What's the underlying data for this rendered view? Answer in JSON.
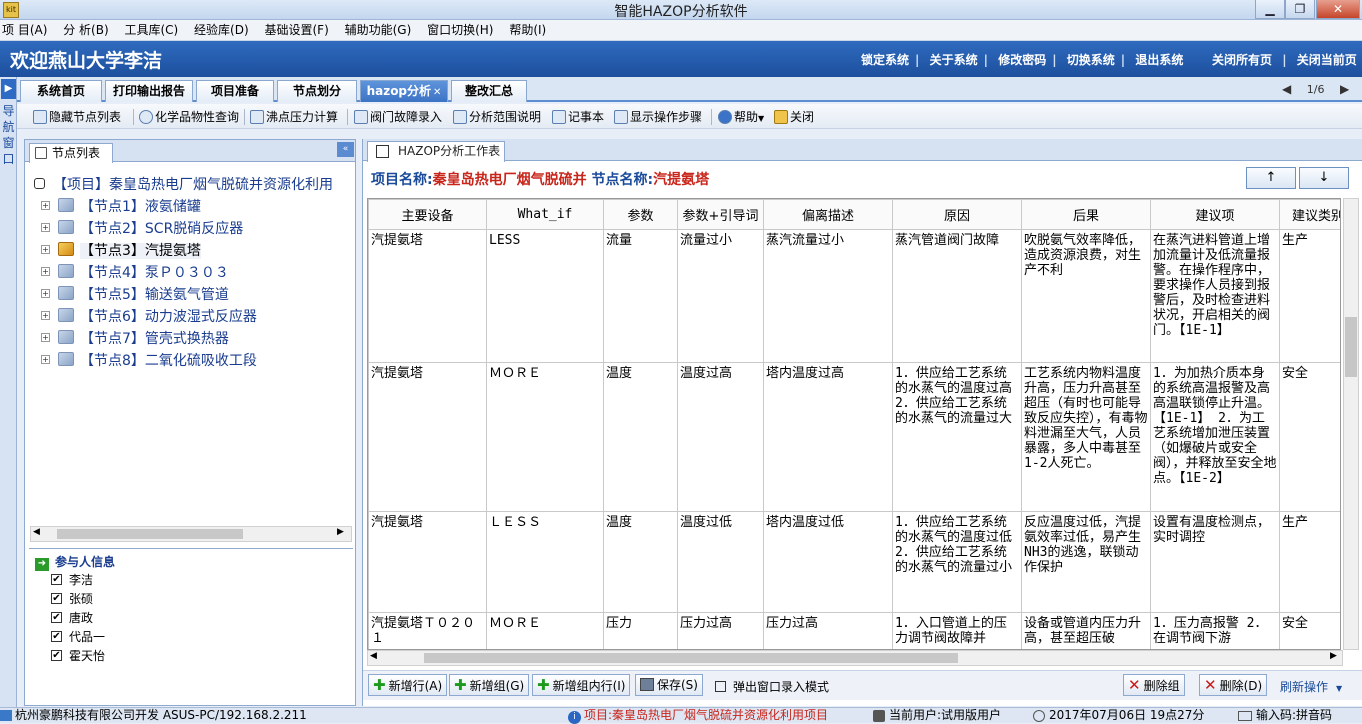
{
  "window": {
    "title": "智能HAZOP分析软件",
    "icon_text": "kit",
    "buttons": [
      "minimize-icon",
      "restore-icon",
      "close-icon"
    ]
  },
  "menu": [
    "项 目(A)",
    "分 析(B)",
    "工具库(C)",
    "经验库(D)",
    "基础设置(F)",
    "辅助功能(G)",
    "窗口切换(H)",
    "帮助(I)"
  ],
  "menu_prefix": "项",
  "header": {
    "welcome": "欢迎燕山大学李洁",
    "links": [
      "锁定系统",
      "关于系统",
      "修改密码",
      "切换系统",
      "退出系统"
    ],
    "right_links": [
      "关闭所有页",
      "关闭当前页"
    ]
  },
  "leftnav": {
    "label": "导航窗口"
  },
  "tabs": [
    "系统首页",
    "打印输出报告",
    "项目准备",
    "节点划分",
    "hazop分析",
    "整改汇总"
  ],
  "active_tab_index": 4,
  "pager": "1/6",
  "toolbar": [
    "隐藏节点列表",
    "化学品物性查询",
    "沸点压力计算",
    "阀门故障录入",
    "分析范围说明",
    "记事本",
    "显示操作步骤",
    "帮助",
    "关闭"
  ],
  "node_panel": {
    "tab": "节点列表",
    "project": "【项目】秦皇岛热电厂烟气脱硫并资源化利用",
    "nodes": [
      "【节点1】液氨储罐",
      "【节点2】SCR脱硝反应器",
      "【节点3】汽提氨塔",
      "【节点4】泵Ｐ０３０３",
      "【节点5】输送氨气管道",
      "【节点6】动力波湿式反应器",
      "【节点7】管壳式换热器",
      "【节点8】二氧化硫吸收工段"
    ],
    "selected_index": 2
  },
  "participants": {
    "title": "参与人信息",
    "people": [
      "李洁",
      "张硕",
      "唐政",
      "代品一",
      "霍天怡"
    ],
    "checked": true
  },
  "worksheet": {
    "tab": "HAZOP分析工作表",
    "project_label": "项目名称:",
    "project_name": "秦皇岛热电厂烟气脱硫并",
    "node_label": "节点名称:",
    "node_name": "汽提氨塔",
    "up_arrow": "↑",
    "down_arrow": "↓",
    "columns": [
      "主要设备",
      "What_if",
      "参数",
      "参数+引导词",
      "偏离描述",
      "原因",
      "后果",
      "建议项",
      "建议类别"
    ],
    "rows": [
      [
        "汽提氨塔",
        "LESS",
        "流量",
        "流量过小",
        "蒸汽流量过小",
        "蒸汽管道阀门故障",
        "吹脱氨气效率降低，造成资源浪费，对生产不利",
        "在蒸汽进料管道上增加流量计及低流量报警。在操作程序中，要求操作人员接到报警后，及时检查进料状况，开启相关的阀门。【1E-1】",
        "生产"
      ],
      [
        "汽提氨塔",
        "ＭＯＲＥ",
        "温度",
        "温度过高",
        "塔内温度过高",
        "1．供应给工艺系统的水蒸气的温度过高 2．供应给工艺系统的水蒸气的流量过大",
        "工艺系统内物料温度升高，压力升高甚至超压（有时也可能导致反应失控），有毒物料泄漏至大气，人员暴露，多人中毒甚至1-2人死亡。",
        "1．为加热介质本身的系统高温报警及高高温联锁停止升温。【1E-1】 2．为工艺系统增加泄压装置（如爆破片或安全阀），并释放至安全地点。【1E-2】",
        "安全"
      ],
      [
        "汽提氨塔",
        "ＬＥＳＳ",
        "温度",
        "温度过低",
        "塔内温度过低",
        "1．供应给工艺系统的水蒸气的温度过低 2．供应给工艺系统的水蒸气的流量过小",
        "反应温度过低，汽提氨效率过低，易产生NH3的逃逸，联锁动作保护",
        "设置有温度检测点，实时调控",
        "生产"
      ],
      [
        "汽提氨塔Ｔ０２０１",
        "ＭＯＲＥ",
        "压力",
        "压力过高",
        "压力过高",
        "1．入口管道上的压力调节阀故障并",
        "设备或管道内压力升高，甚至超压破",
        "1．压力高报警 2．在调节阀下游",
        "安全"
      ]
    ]
  },
  "buttons": {
    "add_row": "新增行(A)",
    "add_group": "新增组(G)",
    "add_group_row": "新增组内行(I)",
    "save": "保存(S)",
    "popup_mode": "弹出窗口录入模式",
    "delete_group": "删除组",
    "delete": "删除(D)",
    "refresh": "刷新操作"
  },
  "status": {
    "company": "杭州豪鹏科技有限公司开发  ASUS-PC/192.168.2.211",
    "project": "项目:秦皇岛热电厂烟气脱硫并资源化利用项目",
    "user": "当前用户:试用版用户",
    "datetime": "2017年07月06日 19点27分",
    "ime": "输入码:拼音码"
  },
  "colors": {
    "header_blue": "#2f6bbf",
    "accent_red": "#c8251b",
    "link_blue": "#1a4a9a"
  }
}
